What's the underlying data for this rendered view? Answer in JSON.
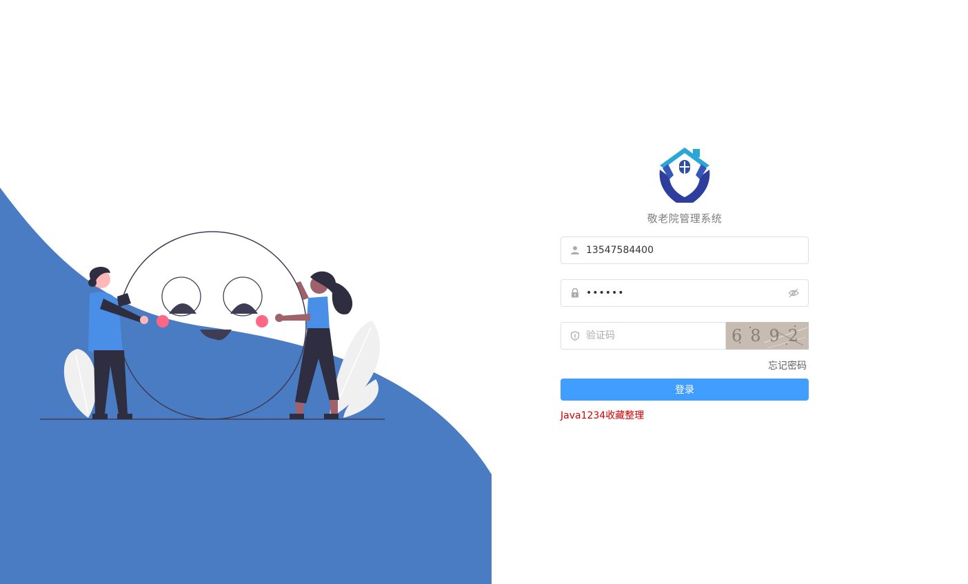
{
  "app": {
    "title": "敬老院管理系统"
  },
  "login": {
    "username_value": "13547584400",
    "password_value": "••••••",
    "captcha_placeholder": "验证码",
    "captcha_image_text": "6892",
    "forgot_label": "忘记密码",
    "submit_label": "登录"
  },
  "footer": {
    "credit": "Java1234收藏整理"
  },
  "colors": {
    "primary": "#409eff",
    "illustration_blue": "#4a7cc3",
    "credit_red": "#d40000"
  }
}
